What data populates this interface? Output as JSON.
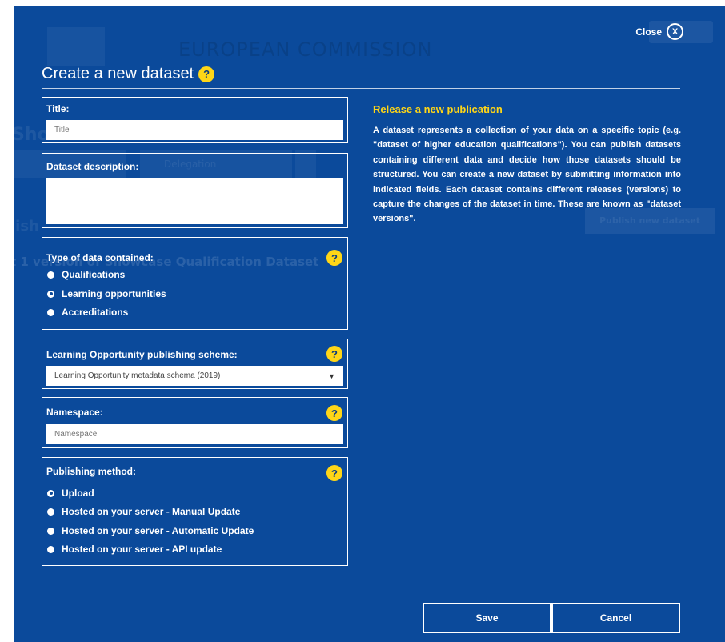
{
  "background": {
    "brand": "EUROPEAN COMMISSION",
    "section_heading": "Sho",
    "select_value": "Delegation",
    "publish_heading": "lish",
    "publish_button": "Publish new dataset",
    "version_line": "t 1 version of Showcase Qualification Dataset"
  },
  "dialog": {
    "close_label": "Close",
    "close_icon_glyph": "X",
    "title": "Create a new dataset",
    "help_glyph": "?"
  },
  "form": {
    "title_field": {
      "label": "Title:",
      "placeholder": "Title"
    },
    "description_field": {
      "label": "Dataset description:",
      "placeholder": ""
    },
    "data_type": {
      "label": "Type of data contained:",
      "options": [
        "Qualifications",
        "Learning opportunities",
        "Accreditations"
      ],
      "selected": "Learning opportunities"
    },
    "scheme": {
      "label": "Learning Opportunity publishing scheme:",
      "selected_value": "Learning Opportunity metadata schema (2019)",
      "arrow": "▼"
    },
    "namespace": {
      "label": "Namespace:",
      "placeholder": "Namespace"
    },
    "publishing_method": {
      "label": "Publishing method:",
      "options": [
        "Upload",
        "Hosted on your server - Manual Update",
        "Hosted on your server - Automatic Update",
        "Hosted on your server - API update"
      ],
      "selected": "Upload"
    }
  },
  "info": {
    "title": "Release a new publication",
    "body": "A dataset represents a collection of your data on a specific topic (e.g. \"dataset of higher education qualifications\"). You can publish datasets containing different data and decide how those datasets should be structured. You can create a new dataset by submitting information into indicated fields. Each dataset contains different releases (versions) to capture the changes of the dataset in time. These are known as \"dataset versions\"."
  },
  "actions": {
    "save": "Save",
    "cancel": "Cancel"
  },
  "colors": {
    "modal_bg": "#0b4a9b",
    "accent": "#ffd617",
    "text": "#ffffff"
  },
  "icons": {
    "close": "close-icon",
    "help": "help-icon",
    "dropdown": "chevron-down-icon"
  }
}
